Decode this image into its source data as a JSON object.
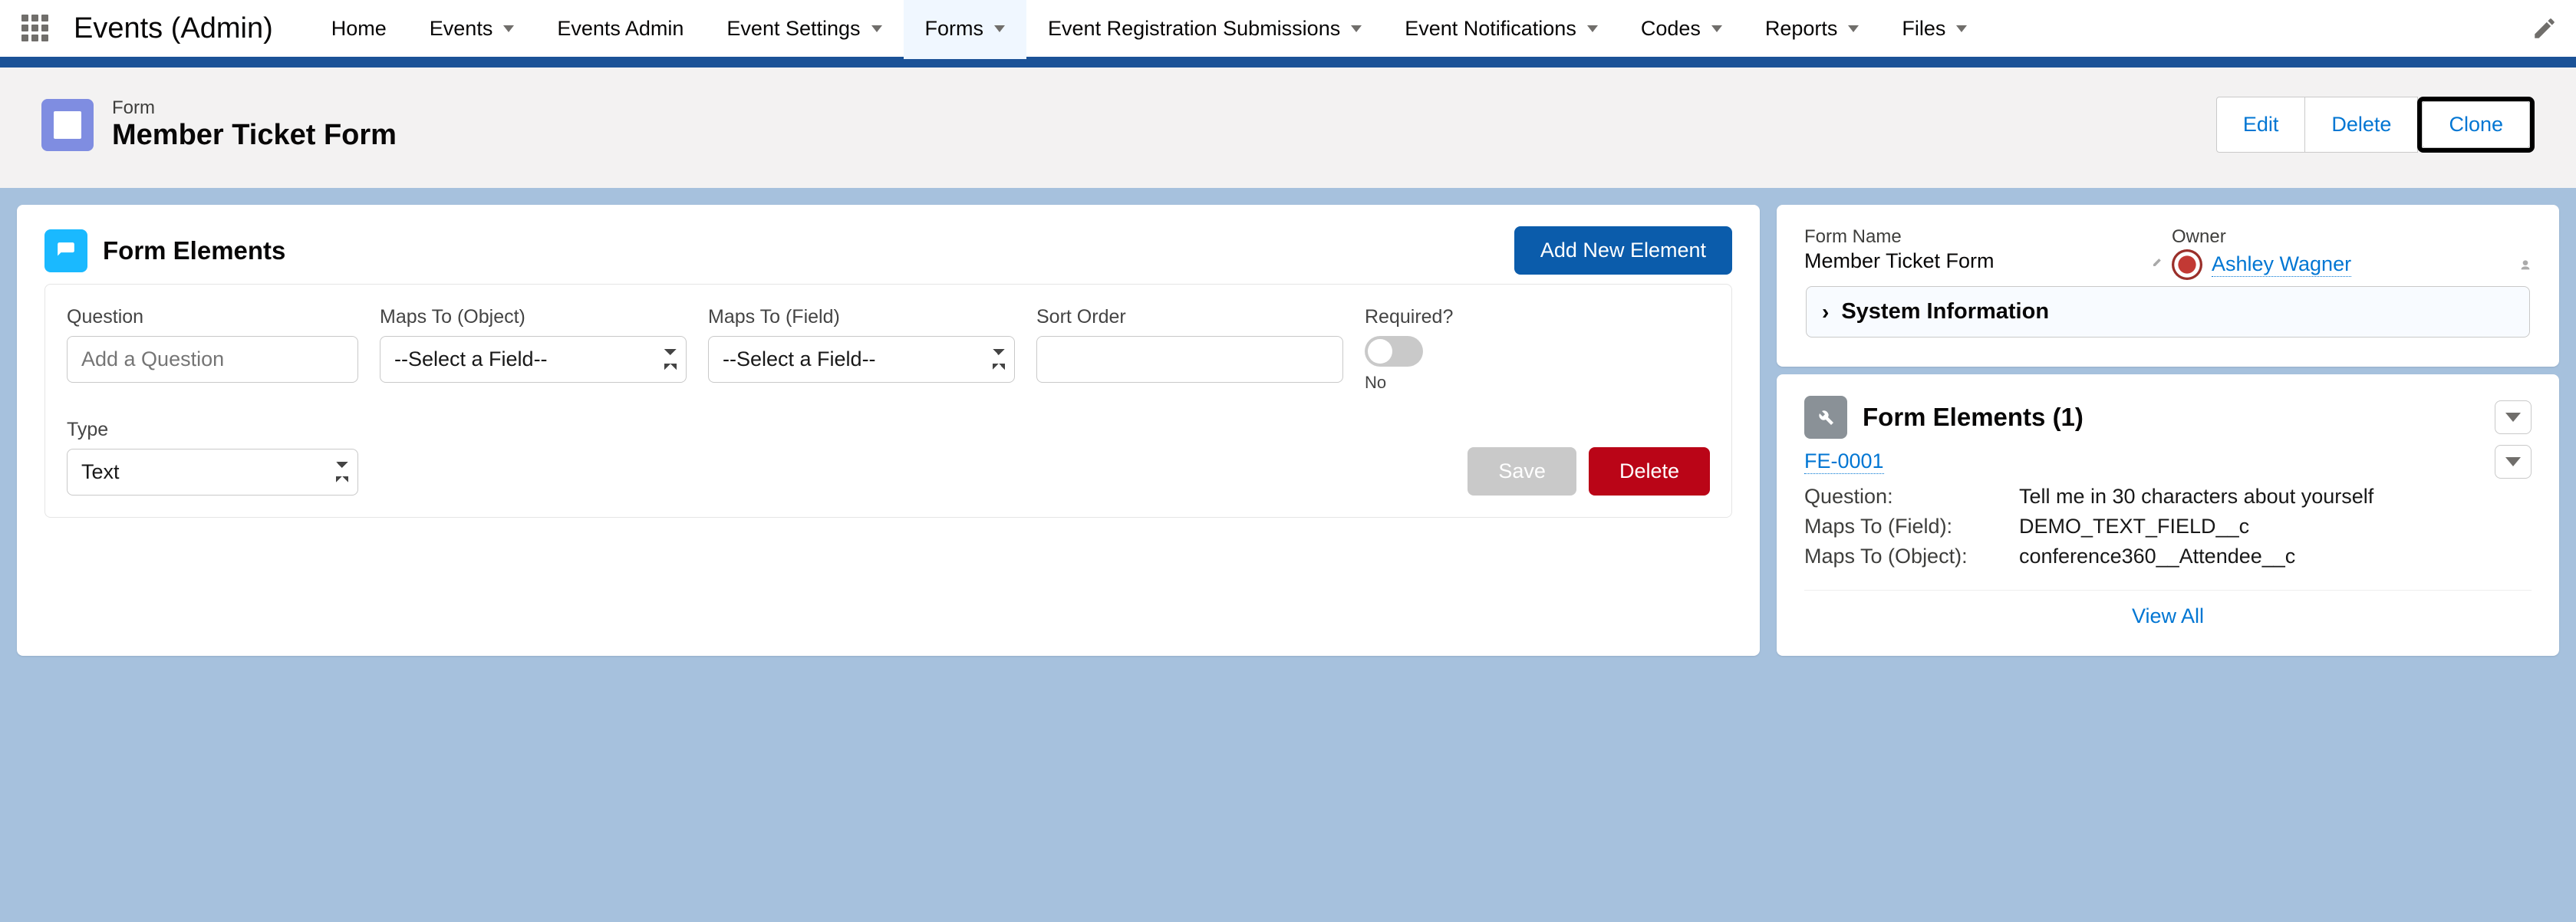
{
  "app_name": "Events (Admin)",
  "nav": [
    {
      "label": "Home",
      "dropdown": false
    },
    {
      "label": "Events",
      "dropdown": true
    },
    {
      "label": "Events Admin",
      "dropdown": false
    },
    {
      "label": "Event Settings",
      "dropdown": true
    },
    {
      "label": "Forms",
      "dropdown": true,
      "active": true
    },
    {
      "label": "Event Registration Submissions",
      "dropdown": true
    },
    {
      "label": "Event Notifications",
      "dropdown": true
    },
    {
      "label": "Codes",
      "dropdown": true
    },
    {
      "label": "Reports",
      "dropdown": true
    },
    {
      "label": "Files",
      "dropdown": true
    }
  ],
  "record": {
    "eyebrow": "Form",
    "title": "Member Ticket Form",
    "actions": {
      "edit": "Edit",
      "delete": "Delete",
      "clone": "Clone"
    }
  },
  "form_elements_card": {
    "title": "Form Elements",
    "add_button": "Add New Element",
    "fields": {
      "question_label": "Question",
      "question_placeholder": "Add a Question",
      "maps_object_label": "Maps To (Object)",
      "maps_object_value": "--Select a Field--",
      "maps_field_label": "Maps To (Field)",
      "maps_field_value": "--Select a Field--",
      "sort_order_label": "Sort Order",
      "sort_order_value": "",
      "required_label": "Required?",
      "required_state": "No",
      "type_label": "Type",
      "type_value": "Text"
    },
    "save_label": "Save",
    "delete_label": "Delete"
  },
  "detail": {
    "form_name_label": "Form Name",
    "form_name_value": "Member Ticket Form",
    "owner_label": "Owner",
    "owner_value": "Ashley Wagner",
    "system_info": "System Information"
  },
  "related": {
    "title": "Form Elements (1)",
    "item_link": "FE-0001",
    "rows": [
      {
        "k": "Question:",
        "v": "Tell me in 30 characters about yourself"
      },
      {
        "k": "Maps To (Field):",
        "v": "DEMO_TEXT_FIELD__c"
      },
      {
        "k": "Maps To (Object):",
        "v": "conference360__Attendee__c"
      }
    ],
    "view_all": "View All"
  }
}
